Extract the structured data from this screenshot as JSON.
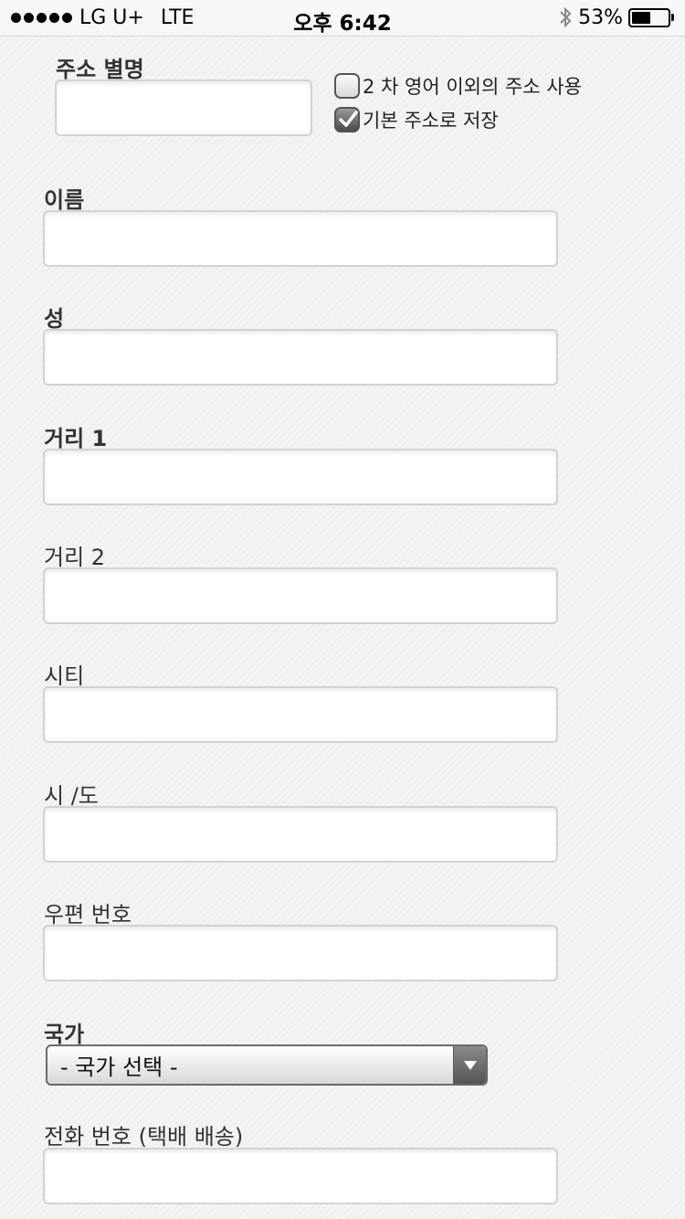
{
  "status_bar": {
    "carrier": "LG U+",
    "network": "LTE",
    "time": "오후 6:42",
    "battery_percent": "53%",
    "battery_level": 0.53
  },
  "form": {
    "address_nickname_label": "주소 별명",
    "secondary_english_checkbox_label": "2 차 영어 이외의 주소 사용",
    "secondary_english_checked": false,
    "save_default_checkbox_label": "기본 주소로 저장",
    "save_default_checked": true,
    "first_name_label": "이름",
    "last_name_label": "성",
    "street1_label": "거리 1",
    "street2_label": "거리 2",
    "city_label": "시티",
    "state_label": "시 /도",
    "postal_code_label": "우편 번호",
    "country_label": "국가",
    "country_select_value": "- 국가 선택 -",
    "phone_label": "전화 번호 (택배 배송)"
  },
  "colors": {
    "background": "#f4f4f4",
    "input_border": "#d2d2d2",
    "select_arrow": "#555555"
  }
}
